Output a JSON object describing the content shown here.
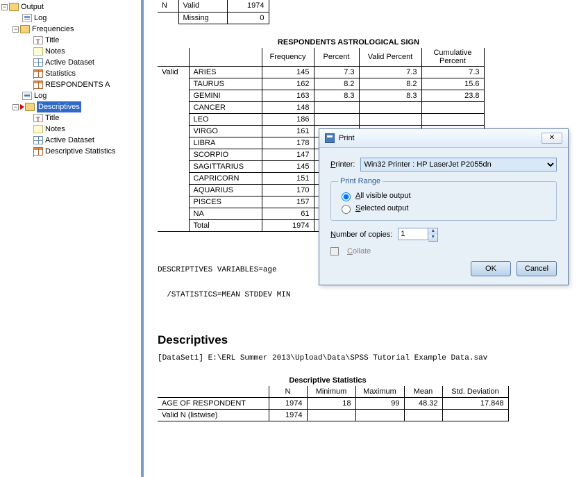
{
  "tree": {
    "output": "Output",
    "log": "Log",
    "frequencies": "Frequencies",
    "title": "Title",
    "notes": "Notes",
    "active_dataset": "Active Dataset",
    "statistics": "Statistics",
    "respondents": "RESPONDENTS A",
    "descriptives": "Descriptives",
    "desc_stats": "Descriptive Statistics"
  },
  "small_table": {
    "row1_lbl1": "N",
    "row1_lbl2": "Valid",
    "row1_val": "1974",
    "row2_lbl": "Missing",
    "row2_val": "0"
  },
  "astro": {
    "title": "RESPONDENTS ASTROLOGICAL SIGN",
    "headers": {
      "freq": "Frequency",
      "pct": "Percent",
      "vpct": "Valid Percent",
      "cpct": "Cumulative Percent"
    },
    "valid_label": "Valid",
    "rows": [
      {
        "sign": "ARIES",
        "freq": "145",
        "pct": "7.3",
        "vpct": "7.3",
        "cpct": "7.3"
      },
      {
        "sign": "TAURUS",
        "freq": "162",
        "pct": "8.2",
        "vpct": "8.2",
        "cpct": "15.6"
      },
      {
        "sign": "GEMINI",
        "freq": "163",
        "pct": "8.3",
        "vpct": "8.3",
        "cpct": "23.8"
      },
      {
        "sign": "CANCER",
        "freq": "148",
        "pct": "",
        "vpct": "",
        "cpct": ""
      },
      {
        "sign": "LEO",
        "freq": "186",
        "pct": "",
        "vpct": "",
        "cpct": ""
      },
      {
        "sign": "VIRGO",
        "freq": "161",
        "pct": "",
        "vpct": "",
        "cpct": ""
      },
      {
        "sign": "LIBRA",
        "freq": "178",
        "pct": "",
        "vpct": "",
        "cpct": ""
      },
      {
        "sign": "SCORPIO",
        "freq": "147",
        "pct": "",
        "vpct": "",
        "cpct": ""
      },
      {
        "sign": "SAGITTARIUS",
        "freq": "145",
        "pct": "",
        "vpct": "",
        "cpct": ""
      },
      {
        "sign": "CAPRICORN",
        "freq": "151",
        "pct": "",
        "vpct": "",
        "cpct": ""
      },
      {
        "sign": "AQUARIUS",
        "freq": "170",
        "pct": "",
        "vpct": "",
        "cpct": ""
      },
      {
        "sign": "PISCES",
        "freq": "157",
        "pct": "",
        "vpct": "",
        "cpct": ""
      },
      {
        "sign": "NA",
        "freq": "61",
        "pct": "",
        "vpct": "",
        "cpct": ""
      },
      {
        "sign": "Total",
        "freq": "1974",
        "pct": "",
        "vpct": "",
        "cpct": ""
      }
    ]
  },
  "syntax": {
    "line1": "DESCRIPTIVES VARIABLES=age",
    "line2": "  /STATISTICS=MEAN STDDEV MIN"
  },
  "desc_section": {
    "heading": "Descriptives",
    "dataset_line": "[DataSet1] E:\\ERL Summer 2013\\Upload\\Data\\SPSS Tutorial Example Data.sav"
  },
  "desc_table": {
    "title": "Descriptive Statistics",
    "headers": {
      "n": "N",
      "min": "Minimum",
      "max": "Maximum",
      "mean": "Mean",
      "std": "Std. Deviation"
    },
    "rows": [
      {
        "label": "AGE OF RESPONDENT",
        "n": "1974",
        "min": "18",
        "max": "99",
        "mean": "48.32",
        "std": "17.848"
      },
      {
        "label": "Valid N (listwise)",
        "n": "1974",
        "min": "",
        "max": "",
        "mean": "",
        "std": ""
      }
    ]
  },
  "dialog": {
    "title": "Print",
    "printer_label": "Printer:",
    "printer_value": "Win32 Printer : HP LaserJet P2055dn",
    "range_legend": "Print Range",
    "all_visible": "All visible output",
    "selected": "Selected output",
    "copies_label": "Number of copies:",
    "copies_value": "1",
    "collate": "Collate",
    "ok": "OK",
    "cancel": "Cancel",
    "close_x": "✕"
  }
}
